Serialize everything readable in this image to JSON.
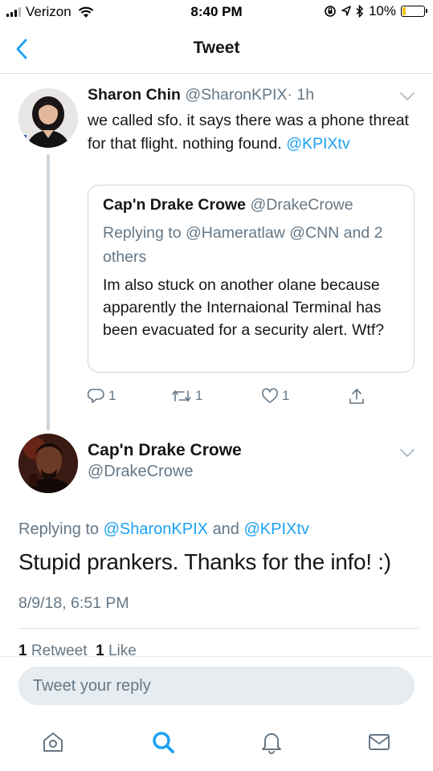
{
  "status_bar": {
    "carrier": "Verizon",
    "time": "8:40 PM",
    "battery": "10%"
  },
  "header": {
    "title": "Tweet",
    "back_icon": "chevron-left-icon"
  },
  "quoting_tweet": {
    "name": "Sharon Chin",
    "handle": "@SharonKPIX",
    "time": "· 1h",
    "text": "we called sfo. it says there was a phone threat for that flight. nothing found.",
    "mention": "@KPIXtv",
    "quoted": {
      "name": "Cap'n Drake Crowe",
      "handle": "@DrakeCrowe",
      "replying_to": "Replying to @Hameratlaw @CNN and 2 others",
      "text": "Im also stuck on another olane because apparently the Internaional Terminal has been evacuated for a security alert. Wtf?"
    },
    "actions": {
      "reply_count": "1",
      "retweet_count": "1",
      "like_count": "1"
    }
  },
  "main_tweet": {
    "name": "Cap'n Drake Crowe",
    "handle": "@DrakeCrowe",
    "replying_prefix": "Replying to",
    "replying_user1": "@SharonKPIX",
    "replying_and": "and",
    "replying_user2": "@KPIXtv",
    "text": "Stupid prankers. Thanks for the info! :)",
    "date": "8/9/18, 6:51 PM",
    "retweets_count": "1",
    "retweets_label": "Retweet",
    "likes_count": "1",
    "likes_label": "Like"
  },
  "reply_bar": {
    "placeholder": "Tweet your reply"
  },
  "tab_bar": {
    "items": [
      "home-icon",
      "search-icon",
      "notifications-icon",
      "messages-icon"
    ]
  },
  "colors": {
    "accent": "#1da1f2",
    "secondary_text": "#657786",
    "battery_low": "#f0c419"
  }
}
